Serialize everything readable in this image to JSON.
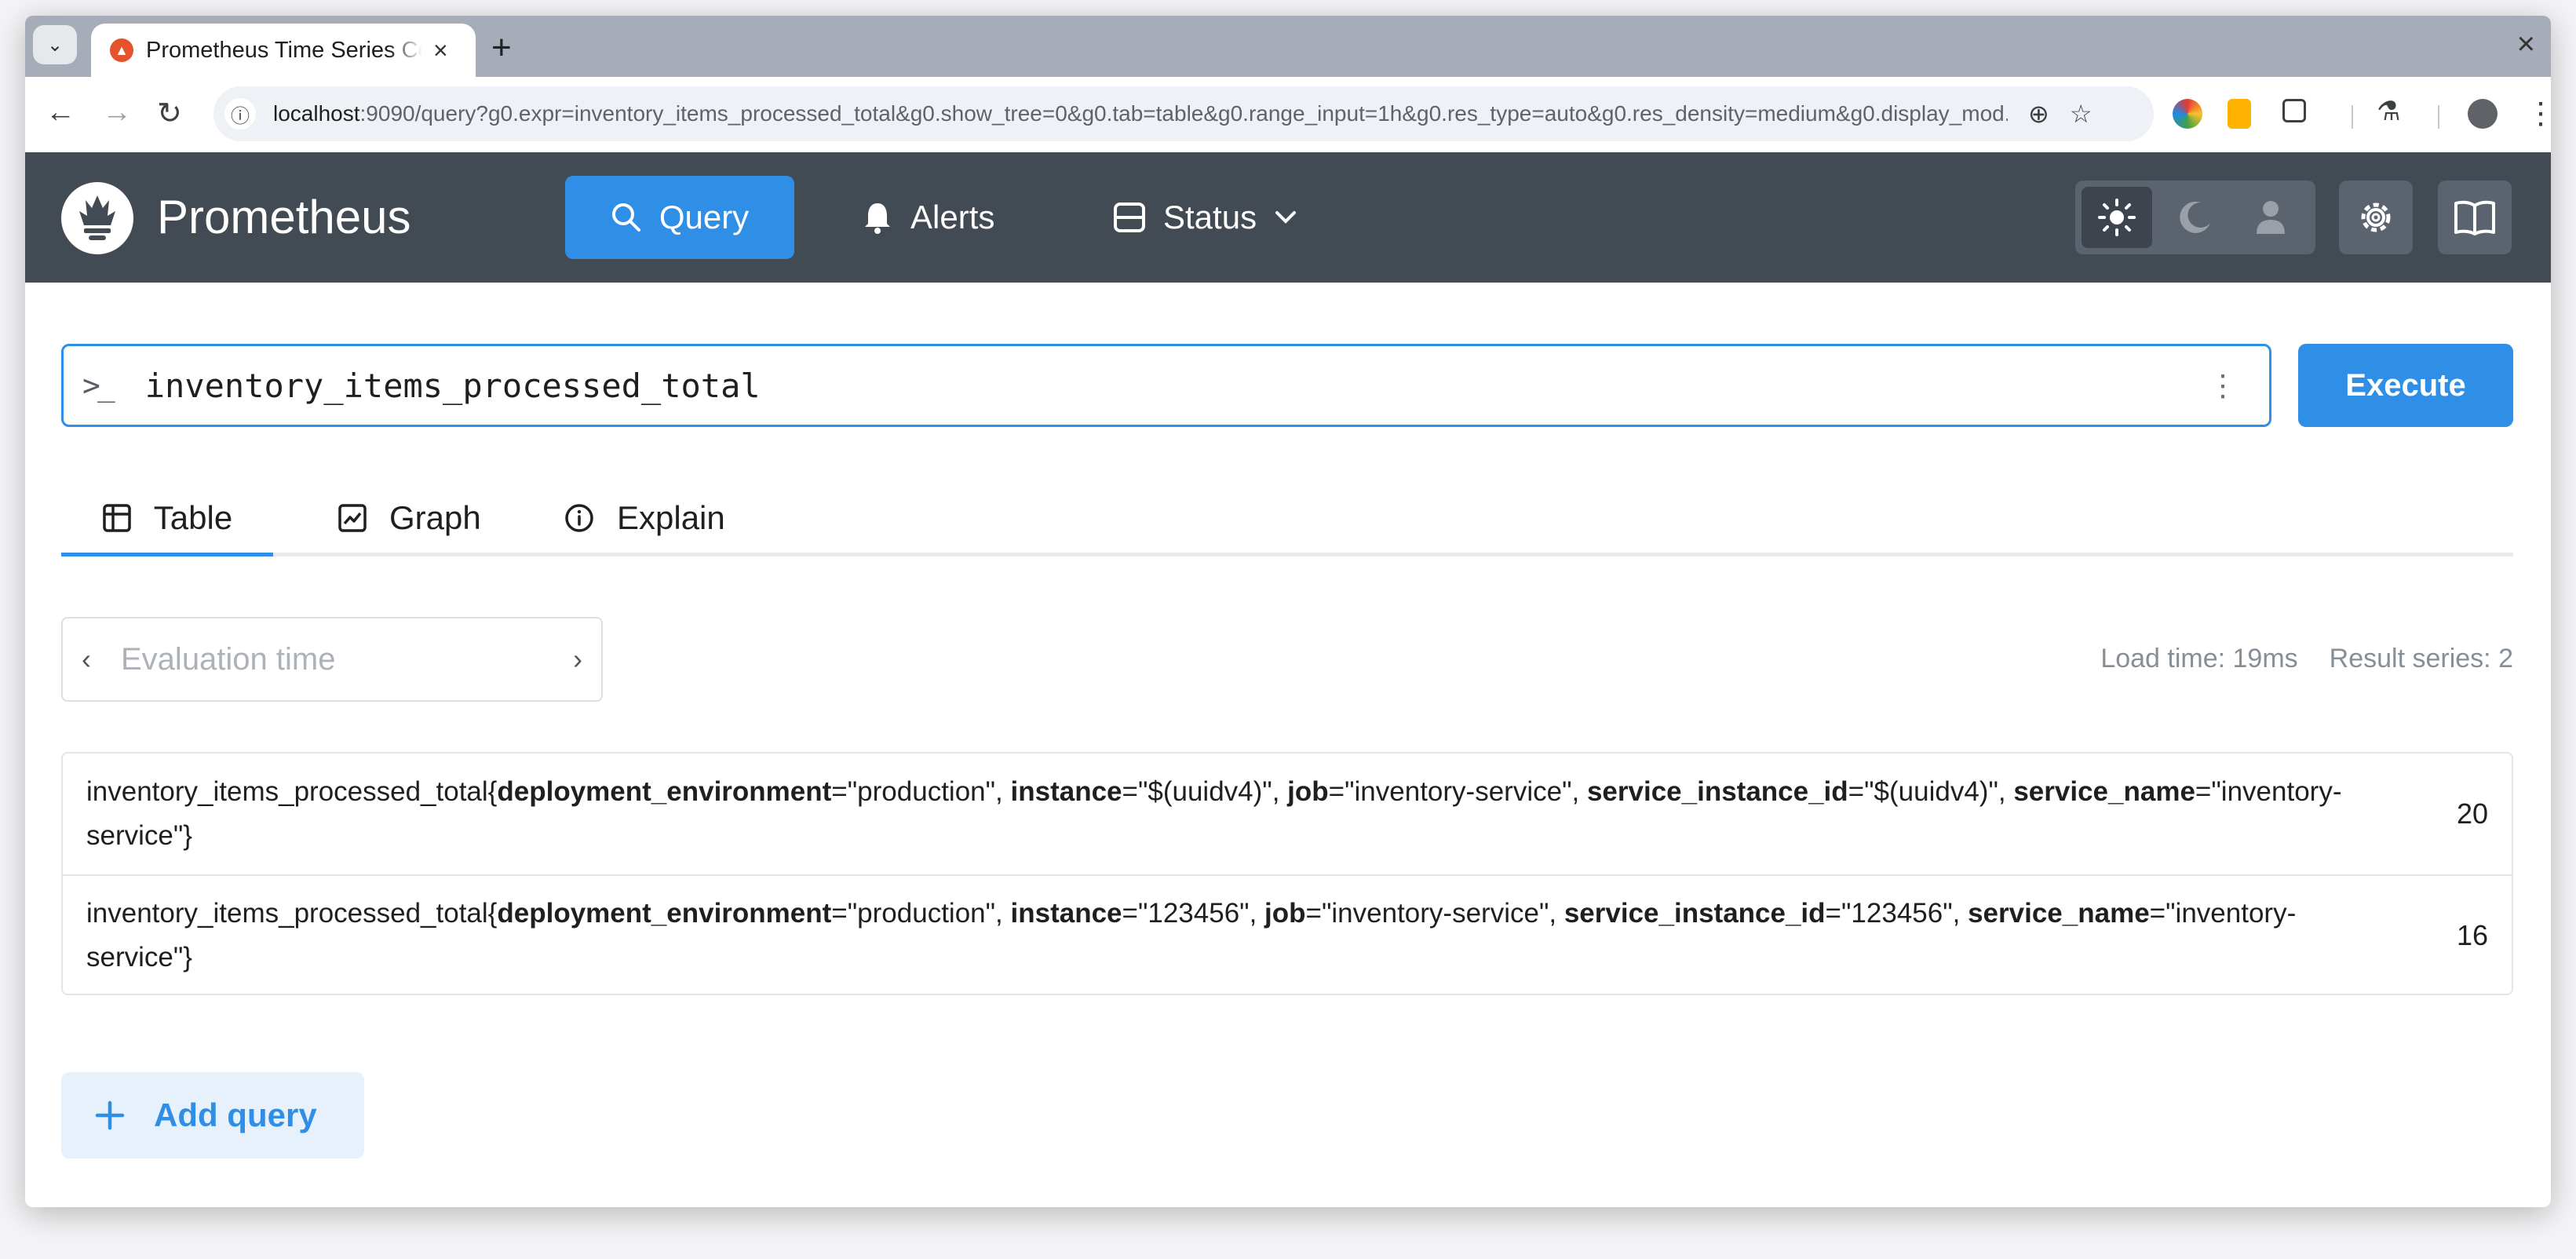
{
  "browser": {
    "tab_title": "Prometheus Time Series Collection and Processing Server",
    "url_host": "localhost",
    "url_rest": ":9090/query?g0.expr=inventory_items_processed_total&g0.show_tree=0&g0.tab=table&g0.range_input=1h&g0.res_type=auto&g0.res_density=medium&g0.display_mod..."
  },
  "header": {
    "brand": "Prometheus",
    "nav": {
      "query": "Query",
      "alerts": "Alerts",
      "status": "Status"
    }
  },
  "query": {
    "expression": "inventory_items_processed_total",
    "execute_label": "Execute"
  },
  "tabs": {
    "table": "Table",
    "graph": "Graph",
    "explain": "Explain"
  },
  "evaluation": {
    "placeholder": "Evaluation time"
  },
  "stats": {
    "load_time": "Load time: 19ms",
    "result_series": "Result series: 2"
  },
  "results": [
    {
      "metric": "inventory_items_processed_total",
      "labels": [
        {
          "name": "deployment_environment",
          "value": "\"production\""
        },
        {
          "name": "instance",
          "value": "\"$(uuidv4)\""
        },
        {
          "name": "job",
          "value": "\"inventory-service\""
        },
        {
          "name": "service_instance_id",
          "value": "\"$(uuidv4)\""
        },
        {
          "name": "service_name",
          "value": "\"inventory-service\""
        }
      ],
      "value": "20"
    },
    {
      "metric": "inventory_items_processed_total",
      "labels": [
        {
          "name": "deployment_environment",
          "value": "\"production\""
        },
        {
          "name": "instance",
          "value": "\"123456\""
        },
        {
          "name": "job",
          "value": "\"inventory-service\""
        },
        {
          "name": "service_instance_id",
          "value": "\"123456\""
        },
        {
          "name": "service_name",
          "value": "\"inventory-service\""
        }
      ],
      "value": "16"
    }
  ],
  "add_query_label": "Add query",
  "colors": {
    "accent": "#2f8ee6",
    "header_bg": "#424a54",
    "add_query_bg": "#e7f1fb"
  }
}
